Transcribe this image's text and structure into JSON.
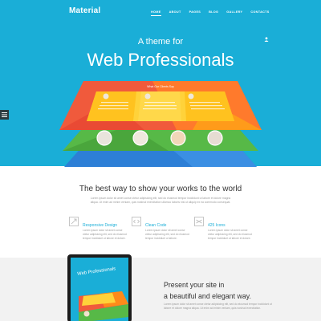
{
  "header": {
    "logo": "Material",
    "nav": [
      {
        "label": "HOME",
        "active": true
      },
      {
        "label": "ABOUT",
        "active": false
      },
      {
        "label": "PAGES",
        "active": false
      },
      {
        "label": "BLOG",
        "active": false
      },
      {
        "label": "GALLERY",
        "active": false
      },
      {
        "label": "CONTACTS",
        "active": false
      }
    ],
    "user_icon": "user-icon"
  },
  "hero": {
    "subtitle": "A theme for",
    "title": "Web Professionals",
    "background": "#1aaed7",
    "card_header": "What Our Clients Say"
  },
  "intro": {
    "title": "The best way to show your works to the world",
    "text": "Lorem ipsum dolor sit amet conse ctetur adipisicing elit, sed do eiusmod tempor incididunt ut labore et dolore magna aliqua. Ut enim ad minim veniam, quis nostrud exercitation ullamco laboris nisi ut aliquip ex ea commodo consequat."
  },
  "features": [
    {
      "icon": "resize-icon",
      "title": "Responsive Design",
      "text": "Lorem ipsum dolor sit amet conse ctetur adipisicing elit, sed do eiusmod tempor incididunt ut labore et dolore."
    },
    {
      "icon": "code-icon",
      "title": "Clean Code",
      "text": "Lorem ipsum dolor sit amet conse ctetur adipisicing elit, sed do eiusmod tempor incididunt ut labore."
    },
    {
      "icon": "layers-icon",
      "title": "425 Icons",
      "text": "Lorem ipsum dolor sit amet conse ctetur adipisicing elit, sed do eiusmod tempor incididunt ut labore et dolore."
    }
  ],
  "present": {
    "title_line1": "Present your site in",
    "title_line2": "a beautiful and elegant way.",
    "text": "Lorem ipsum dolor sit amet conse ctetur adipisicing elit, sed do eiusmod tempor incididunt ut labore et dolore magna aliqua. Ut enim ad minim veniam, quis nostrud exercitation.",
    "screen_title": "Web Professionals"
  },
  "colors": {
    "accent": "#1aaed7",
    "red": "#f05a3c",
    "orange": "#ff9b1a",
    "yellow": "#ffd23a",
    "green": "#57b947",
    "blue": "#2d7fd6"
  }
}
